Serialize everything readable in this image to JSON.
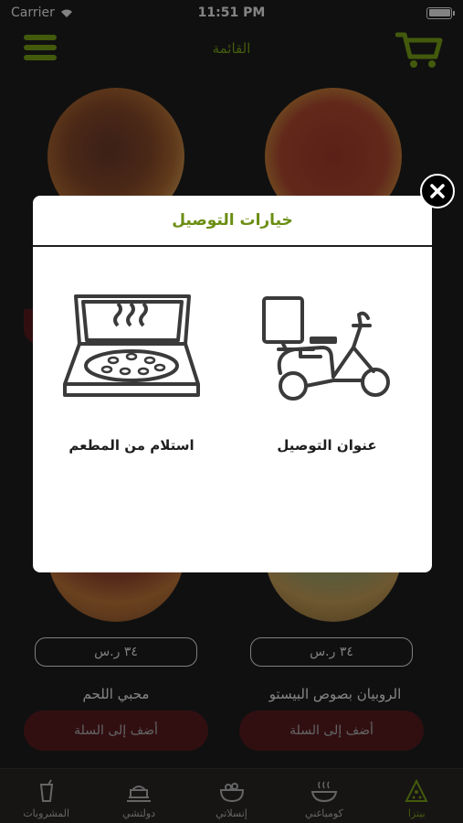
{
  "status_bar": {
    "carrier": "Carrier",
    "time": "11:51 PM"
  },
  "navbar": {
    "title": "القائمة"
  },
  "products": [
    {
      "price": "٣٤ ر.س",
      "name": "محبي اللحم",
      "add_label": "أضف إلى السلة"
    },
    {
      "price": "٣٤ ر.س",
      "name": "الروبيان بصوص البيستو",
      "add_label": "أضف إلى السلة"
    }
  ],
  "tabs": [
    {
      "label": "المشروبات",
      "icon": "drink-icon"
    },
    {
      "label": "دولتشي",
      "icon": "dessert-icon"
    },
    {
      "label": "إنسلاتي",
      "icon": "salad-icon"
    },
    {
      "label": "كومباغني",
      "icon": "bowl-icon"
    },
    {
      "label": "بيتزا",
      "icon": "pizza-slice-icon"
    }
  ],
  "modal": {
    "title": "خيارات التوصيل",
    "options": [
      {
        "label": "عنوان التوصيل",
        "icon": "scooter-icon"
      },
      {
        "label": "استلام من المطعم",
        "icon": "pizza-box-icon"
      }
    ]
  },
  "colors": {
    "accent": "#7aa416",
    "button": "#5a1c1f",
    "background": "#1e1e1e"
  }
}
